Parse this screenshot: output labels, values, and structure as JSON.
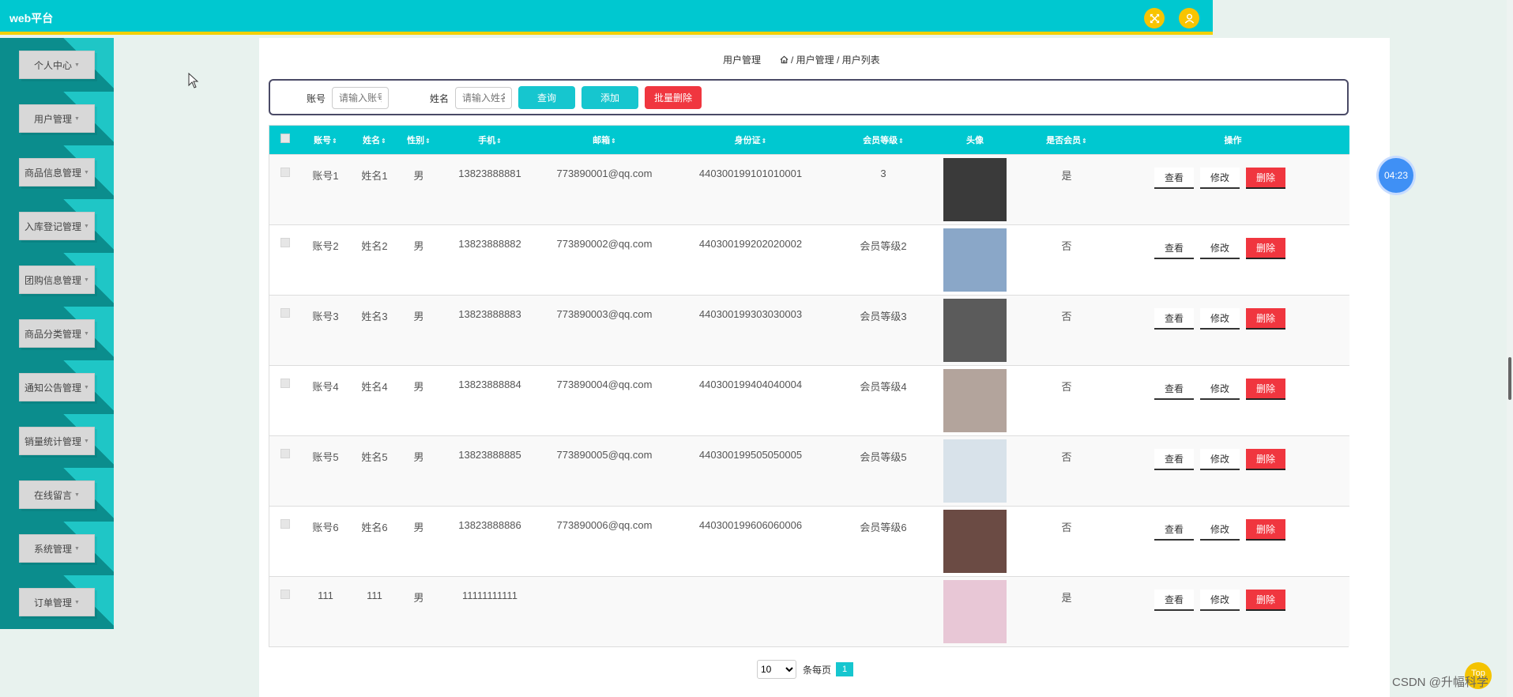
{
  "app": {
    "title": "web平台"
  },
  "sidebar": {
    "items": [
      {
        "label": "个人中心"
      },
      {
        "label": "用户管理"
      },
      {
        "label": "商品信息管理"
      },
      {
        "label": "入库登记管理"
      },
      {
        "label": "团购信息管理"
      },
      {
        "label": "商品分类管理"
      },
      {
        "label": "通知公告管理"
      },
      {
        "label": "销量统计管理"
      },
      {
        "label": "在线留言"
      },
      {
        "label": "系统管理"
      },
      {
        "label": "订单管理"
      }
    ],
    "caret": "▼"
  },
  "breadcrumb": {
    "section": "用户管理",
    "path": "/ 用户管理 / 用户列表"
  },
  "search": {
    "account_label": "账号",
    "account_placeholder": "请输入账号",
    "name_label": "姓名",
    "name_placeholder": "请输入姓名",
    "query_button": "查询",
    "add_button": "添加",
    "batch_delete_button": "批量删除"
  },
  "table": {
    "headers": [
      "账号",
      "姓名",
      "性别",
      "手机",
      "邮箱",
      "身份证",
      "会员等级",
      "头像",
      "是否会员",
      "操作"
    ],
    "sort_glyph": "⇕",
    "rows": [
      {
        "account": "账号1",
        "name": "姓名1",
        "gender": "男",
        "phone": "13823888881",
        "email": "773890001@qq.com",
        "id_card": "440300199101010001",
        "level": "3",
        "member": "是",
        "avatar_color": "#3a3a3a"
      },
      {
        "account": "账号2",
        "name": "姓名2",
        "gender": "男",
        "phone": "13823888882",
        "email": "773890002@qq.com",
        "id_card": "440300199202020002",
        "level": "会员等级2",
        "member": "否",
        "avatar_color": "#8aa7c8"
      },
      {
        "account": "账号3",
        "name": "姓名3",
        "gender": "男",
        "phone": "13823888883",
        "email": "773890003@qq.com",
        "id_card": "440300199303030003",
        "level": "会员等级3",
        "member": "否",
        "avatar_color": "#5b5b5b"
      },
      {
        "account": "账号4",
        "name": "姓名4",
        "gender": "男",
        "phone": "13823888884",
        "email": "773890004@qq.com",
        "id_card": "440300199404040004",
        "level": "会员等级4",
        "member": "否",
        "avatar_color": "#b3a49c"
      },
      {
        "account": "账号5",
        "name": "姓名5",
        "gender": "男",
        "phone": "13823888885",
        "email": "773890005@qq.com",
        "id_card": "440300199505050005",
        "level": "会员等级5",
        "member": "否",
        "avatar_color": "#d8e2ea"
      },
      {
        "account": "账号6",
        "name": "姓名6",
        "gender": "男",
        "phone": "13823888886",
        "email": "773890006@qq.com",
        "id_card": "440300199606060006",
        "level": "会员等级6",
        "member": "否",
        "avatar_color": "#6b4b44"
      },
      {
        "account": "111",
        "name": "111",
        "gender": "男",
        "phone": "11111111111",
        "email": "",
        "id_card": "",
        "level": "",
        "member": "是",
        "avatar_color": "#e8c7d6"
      }
    ],
    "ops": {
      "view": "查看",
      "edit": "修改",
      "delete": "删除"
    }
  },
  "pagination": {
    "page_size": "10",
    "per_page_label": "条每页",
    "current_page": "1"
  },
  "floating": {
    "timer": "04:23",
    "top_label": "Top",
    "watermark": "CSDN @升幅科学"
  },
  "colors": {
    "accent": "#00c8d0",
    "topbar_border": "#f4d000",
    "sidebar": "#0b8d8d",
    "danger": "#f0363f",
    "top_buttons": "#f8c400"
  }
}
